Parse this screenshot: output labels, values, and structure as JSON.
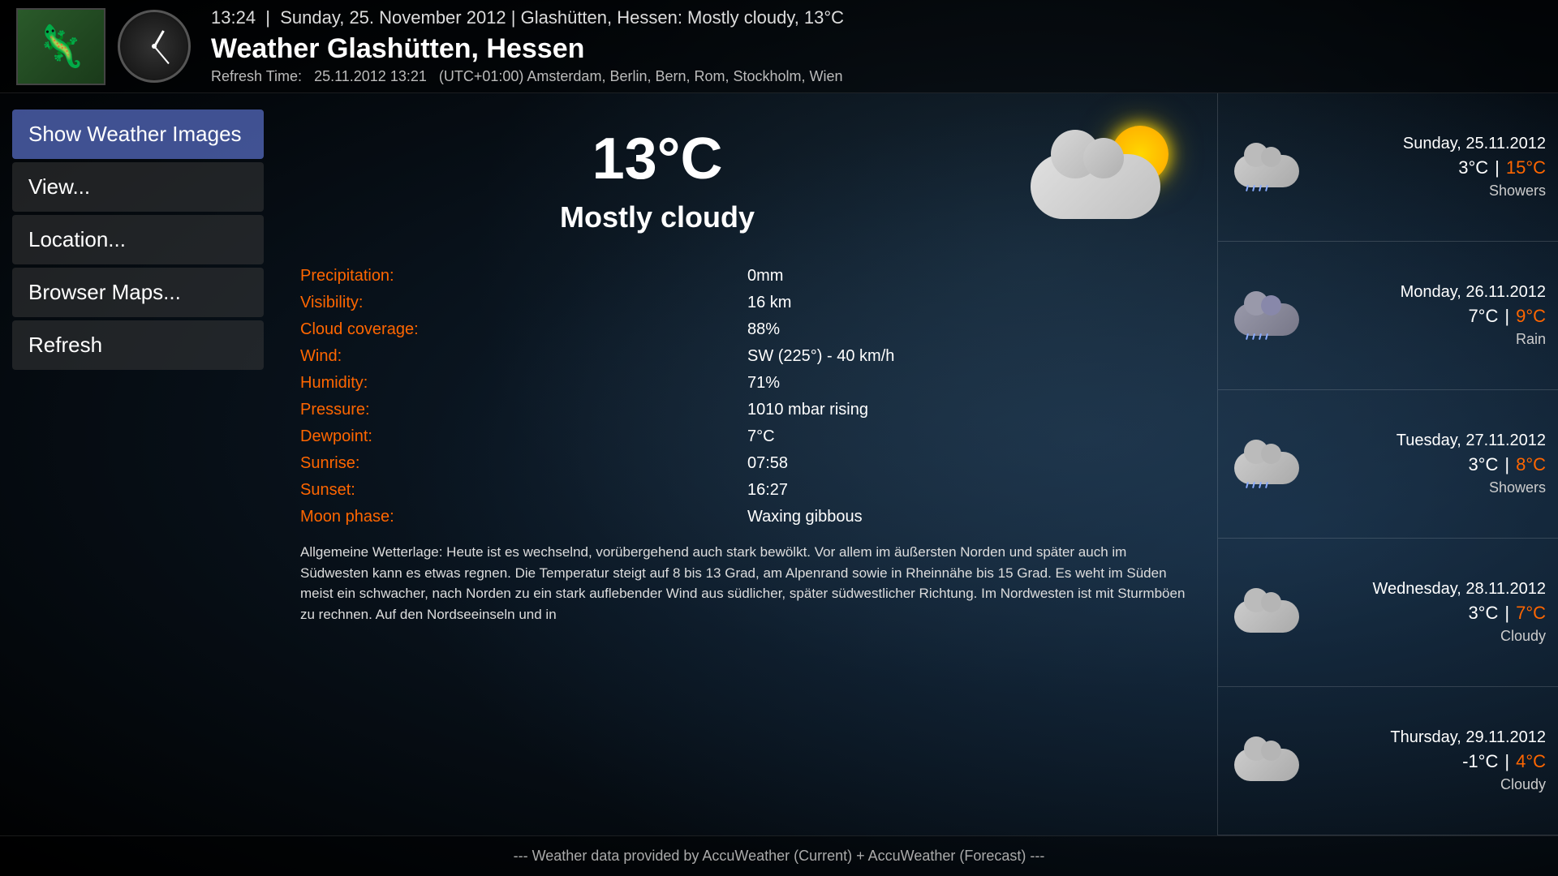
{
  "header": {
    "time": "13:24",
    "date_location": "Sunday, 25. November 2012  |  Glashütten, Hessen: Mostly cloudy, 13°C",
    "title": "Weather  Glashütten, Hessen",
    "refresh_label": "Refresh Time:",
    "refresh_time": "25.11.2012 13:21",
    "timezone": "(UTC+01:00) Amsterdam, Berlin, Bern, Rom, Stockholm, Wien"
  },
  "sidebar": {
    "buttons": [
      {
        "id": "show-weather-images",
        "label": "Show Weather Images",
        "active": true
      },
      {
        "id": "view",
        "label": "View...",
        "active": false
      },
      {
        "id": "location",
        "label": "Location...",
        "active": false
      },
      {
        "id": "browser-maps",
        "label": "Browser Maps...",
        "active": false
      },
      {
        "id": "refresh",
        "label": "Refresh",
        "active": false
      }
    ]
  },
  "current": {
    "temperature": "13°C",
    "condition": "Mostly cloudy",
    "details": [
      {
        "label": "Precipitation:",
        "value": "0mm"
      },
      {
        "label": "Visibility:",
        "value": "16 km"
      },
      {
        "label": "Cloud coverage:",
        "value": "88%"
      },
      {
        "label": "Wind:",
        "value": "SW (225°) - 40 km/h"
      },
      {
        "label": "Humidity:",
        "value": "71%"
      },
      {
        "label": "Pressure:",
        "value": "1010 mbar  rising"
      },
      {
        "label": "Dewpoint:",
        "value": "7°C"
      },
      {
        "label": "Sunrise:",
        "value": "07:58"
      },
      {
        "label": "Sunset:",
        "value": "16:27"
      },
      {
        "label": "Moon phase:",
        "value": "Waxing gibbous"
      }
    ],
    "description": "Allgemeine Wetterlage: Heute ist es wechselnd, vorübergehend auch stark bewölkt. Vor allem im äußersten Norden und später auch im Südwesten kann es etwas regnen. Die Temperatur steigt auf 8 bis 13 Grad, am Alpenrand sowie in Rheinnähe bis 15 Grad. Es weht im Süden meist ein schwacher, nach Norden zu ein stark auflebender Wind aus südlicher, später südwestlicher Richtung. Im Nordwesten ist mit Sturmböen zu rechnen. Auf den Nordseeinseln und in"
  },
  "forecast": [
    {
      "date": "Sunday, 25.11.2012",
      "low": "3°C",
      "high": "15°C",
      "condition": "Showers",
      "cloud_type": "showers"
    },
    {
      "date": "Monday, 26.11.2012",
      "low": "7°C",
      "high": "9°C",
      "condition": "Rain",
      "cloud_type": "rain"
    },
    {
      "date": "Tuesday, 27.11.2012",
      "low": "3°C",
      "high": "8°C",
      "condition": "Showers",
      "cloud_type": "showers"
    },
    {
      "date": "Wednesday, 28.11.2012",
      "low": "3°C",
      "high": "7°C",
      "condition": "Cloudy",
      "cloud_type": "cloudy"
    },
    {
      "date": "Thursday, 29.11.2012",
      "low": "-1°C",
      "high": "4°C",
      "condition": "Cloudy",
      "cloud_type": "cloudy"
    }
  ],
  "footer": {
    "text": "---  Weather data provided by AccuWeather (Current) + AccuWeather (Forecast)  ---"
  },
  "colors": {
    "accent": "#ff6600",
    "active_btn": "rgba(80,100,180,0.8)"
  }
}
